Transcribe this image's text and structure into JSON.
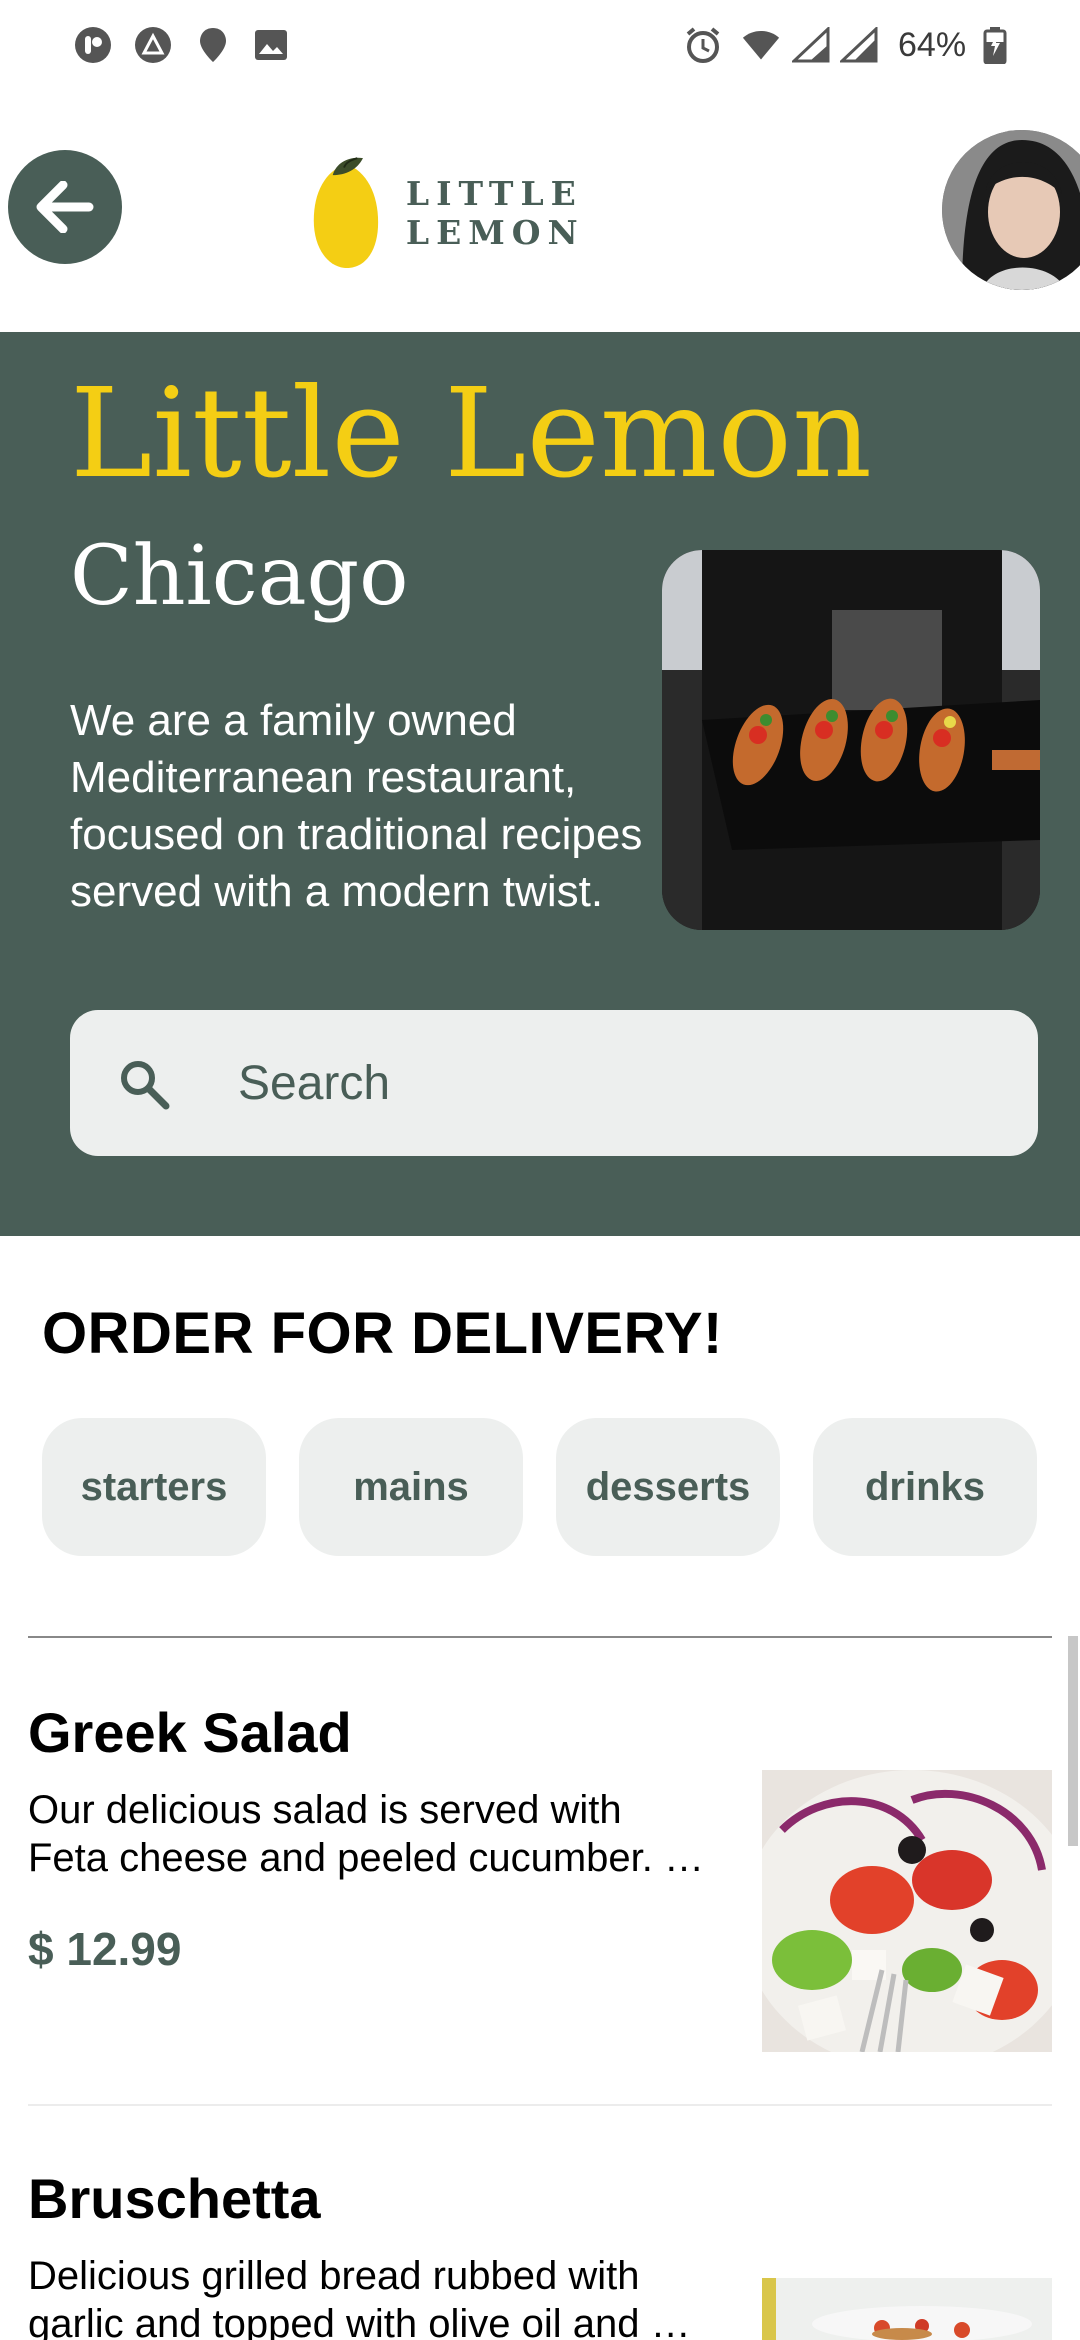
{
  "status_bar": {
    "battery_text": "64%",
    "icons": [
      "pocketcasts-icon",
      "autodesk-icon",
      "location-icon",
      "gallery-icon",
      "alarm-icon",
      "wifi-icon",
      "signal-icon",
      "signal-icon",
      "battery-charging-icon"
    ]
  },
  "header": {
    "logo_text": "LITTLE LEMON",
    "back_icon": "arrow-left-icon"
  },
  "hero": {
    "title": "Little Lemon",
    "city": "Chicago",
    "description": "We are a family owned Mediterranean restaurant, focused on traditional recipes served with a modern twist."
  },
  "search": {
    "placeholder": "Search",
    "value": ""
  },
  "order": {
    "title": "ORDER FOR DELIVERY!",
    "categories": [
      "starters",
      "mains",
      "desserts",
      "drinks"
    ]
  },
  "menu": {
    "items": [
      {
        "name": "Greek Salad",
        "description_line1": "Our delicious salad is served with",
        "description_line2": "Feta cheese and peeled cucumber. Includes tomatoes, onions, olives",
        "price": "$ 12.99"
      },
      {
        "name": "Bruschetta",
        "description_line1": "Delicious grilled bread rubbed with",
        "description_line2": "garlic and topped with olive oil and salt",
        "price": ""
      }
    ]
  },
  "colors": {
    "primary": "#495e57",
    "accent_yellow": "#f4ce14",
    "chip_bg": "#edefee"
  }
}
